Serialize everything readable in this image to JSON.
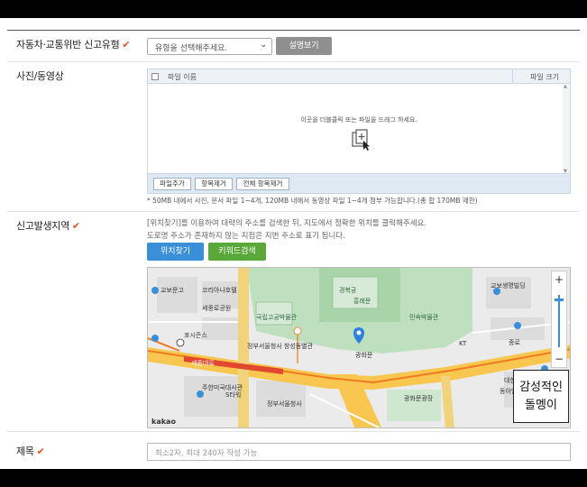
{
  "report_type": {
    "label": "자동차·교통위반 신고유형",
    "select_value": "유형을 선택해주세요.",
    "explain_button": "설명보기"
  },
  "media": {
    "label": "사진/동영상",
    "col_name": "파일 이름",
    "col_size": "파일 크기",
    "hint": "이곳을 더블클릭 또는 파일을 드래그 하세요.",
    "buttons": [
      "파일추가",
      "항목제거",
      "전체 항목제거"
    ],
    "note": "* 50MB 내에서 사진, 문서 파일 1~4개, 120MB 내에서 동영상 파일 1~4개 첨부 가능합니다.(총 합 170MB 제한)"
  },
  "location": {
    "label": "신고발생지역",
    "desc1": "[위치찾기]를 이용하여 대략의 주소를 검색한 뒤, 지도에서 정확한 위치를 클릭해주세요.",
    "desc2": "도로명 주소가 존재하지 않는 지점은 지번 주소로 표기 됩니다.",
    "find_button": "위치찾기",
    "keyword_button": "키워드검색",
    "map": {
      "labels": [
        "교보문고",
        "광화문",
        "광화문광장",
        "정부서울청사",
        "세종대로",
        "종로",
        "경복궁",
        "흥례문",
        "민속박물관",
        "국립고궁박물관",
        "주한미국대사관",
        "포시즌스",
        "KT",
        "S타워",
        "대한민국역사박물관",
        "코리아나호텔",
        "동아일보",
        "교보생명빌딩",
        "세종로공원",
        "정부서울청사 창성동별관"
      ],
      "logo": "kakao",
      "zoom_in": "+",
      "zoom_out": "−"
    }
  },
  "overlay": {
    "line1": "감성적인",
    "line2": "돌멩이"
  },
  "title_field": {
    "label": "제목",
    "placeholder": "최소2자, 최대 240자 작성 가능"
  },
  "colors": {
    "accent": "#e8541e",
    "blue": "#3a8fd9",
    "green": "#5aa73a",
    "gray_button": "#8f8f8f"
  }
}
